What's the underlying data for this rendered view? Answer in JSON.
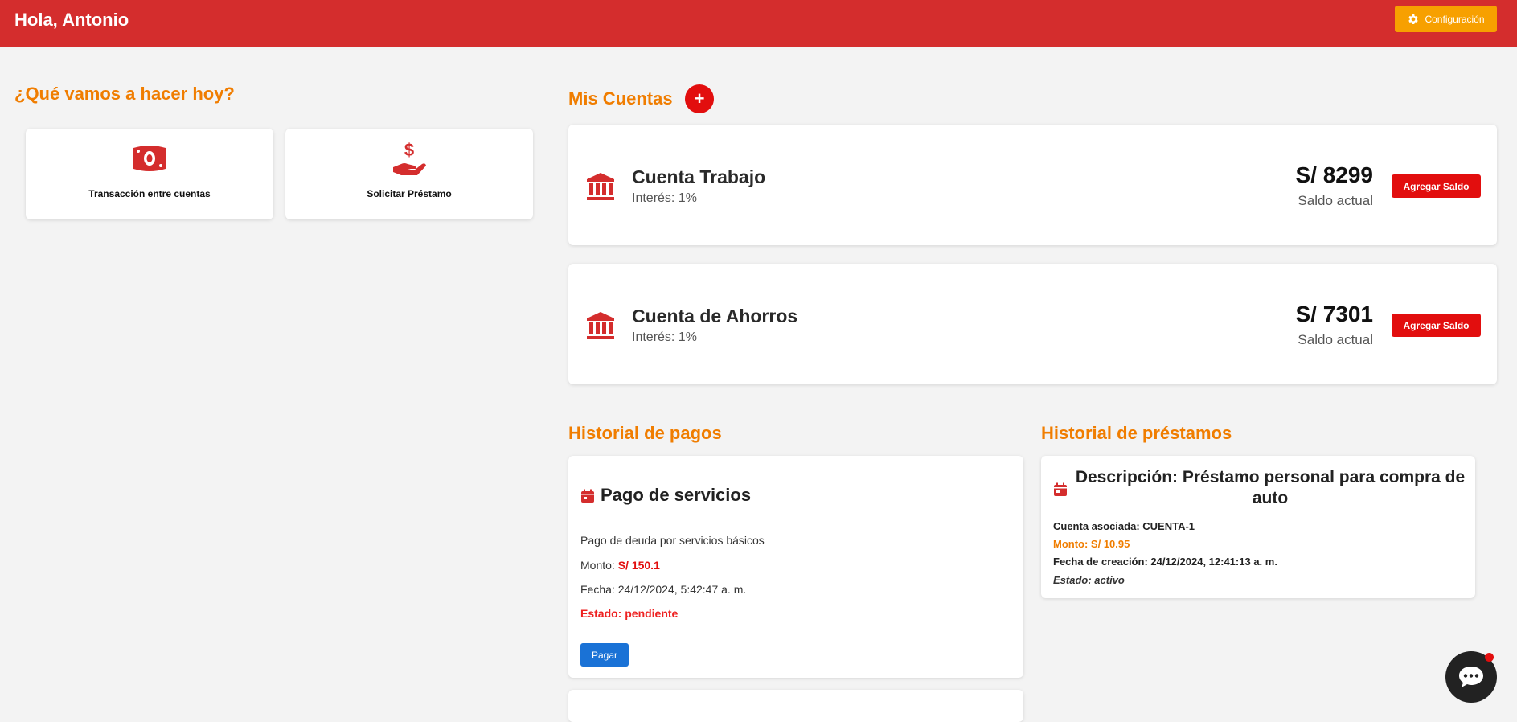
{
  "header": {
    "greeting": "Hola, Antonio",
    "config_label": "Configuración",
    "bg_color": "#d42d2d",
    "config_color": "#f7a000"
  },
  "actions": {
    "title": "¿Qué vamos a hacer hoy?",
    "items": [
      {
        "label": "Transacción entre cuentas",
        "icon": "money-bill-icon"
      },
      {
        "label": "Solicitar Préstamo",
        "icon": "hand-holding-dollar-icon"
      }
    ]
  },
  "accounts": {
    "title": "Mis Cuentas",
    "add_label": "+",
    "items": [
      {
        "name": "Cuenta Trabajo",
        "interest": "Interés: 1%",
        "balance": "S/ 8299",
        "balance_label": "Saldo actual",
        "button": "Agregar Saldo"
      },
      {
        "name": "Cuenta de Ahorros",
        "interest": "Interés: 1%",
        "balance": "S/ 7301",
        "balance_label": "Saldo actual",
        "button": "Agregar Saldo"
      }
    ]
  },
  "payments": {
    "title": "Historial de pagos",
    "items": [
      {
        "title": "Pago de servicios",
        "description": "Pago de deuda por servicios básicos",
        "amount_label": "Monto:",
        "amount": "S/ 150.1",
        "date": "Fecha: 24/12/2024, 5:42:47 a. m.",
        "state": "Estado: pendiente",
        "button": "Pagar"
      }
    ]
  },
  "loans": {
    "title": "Historial de préstamos",
    "items": [
      {
        "description": "Descripción: Préstamo personal para compra de auto",
        "account": "Cuenta asociada: CUENTA-1",
        "amount": "Monto: S/ 10.95",
        "created": "Fecha de creación: 24/12/2024, 12:41:13 a. m.",
        "state": "Estado: activo"
      }
    ]
  },
  "colors": {
    "accent_orange": "#f07d00",
    "primary_red": "#e20e0e",
    "pay_blue": "#1a72d6"
  }
}
